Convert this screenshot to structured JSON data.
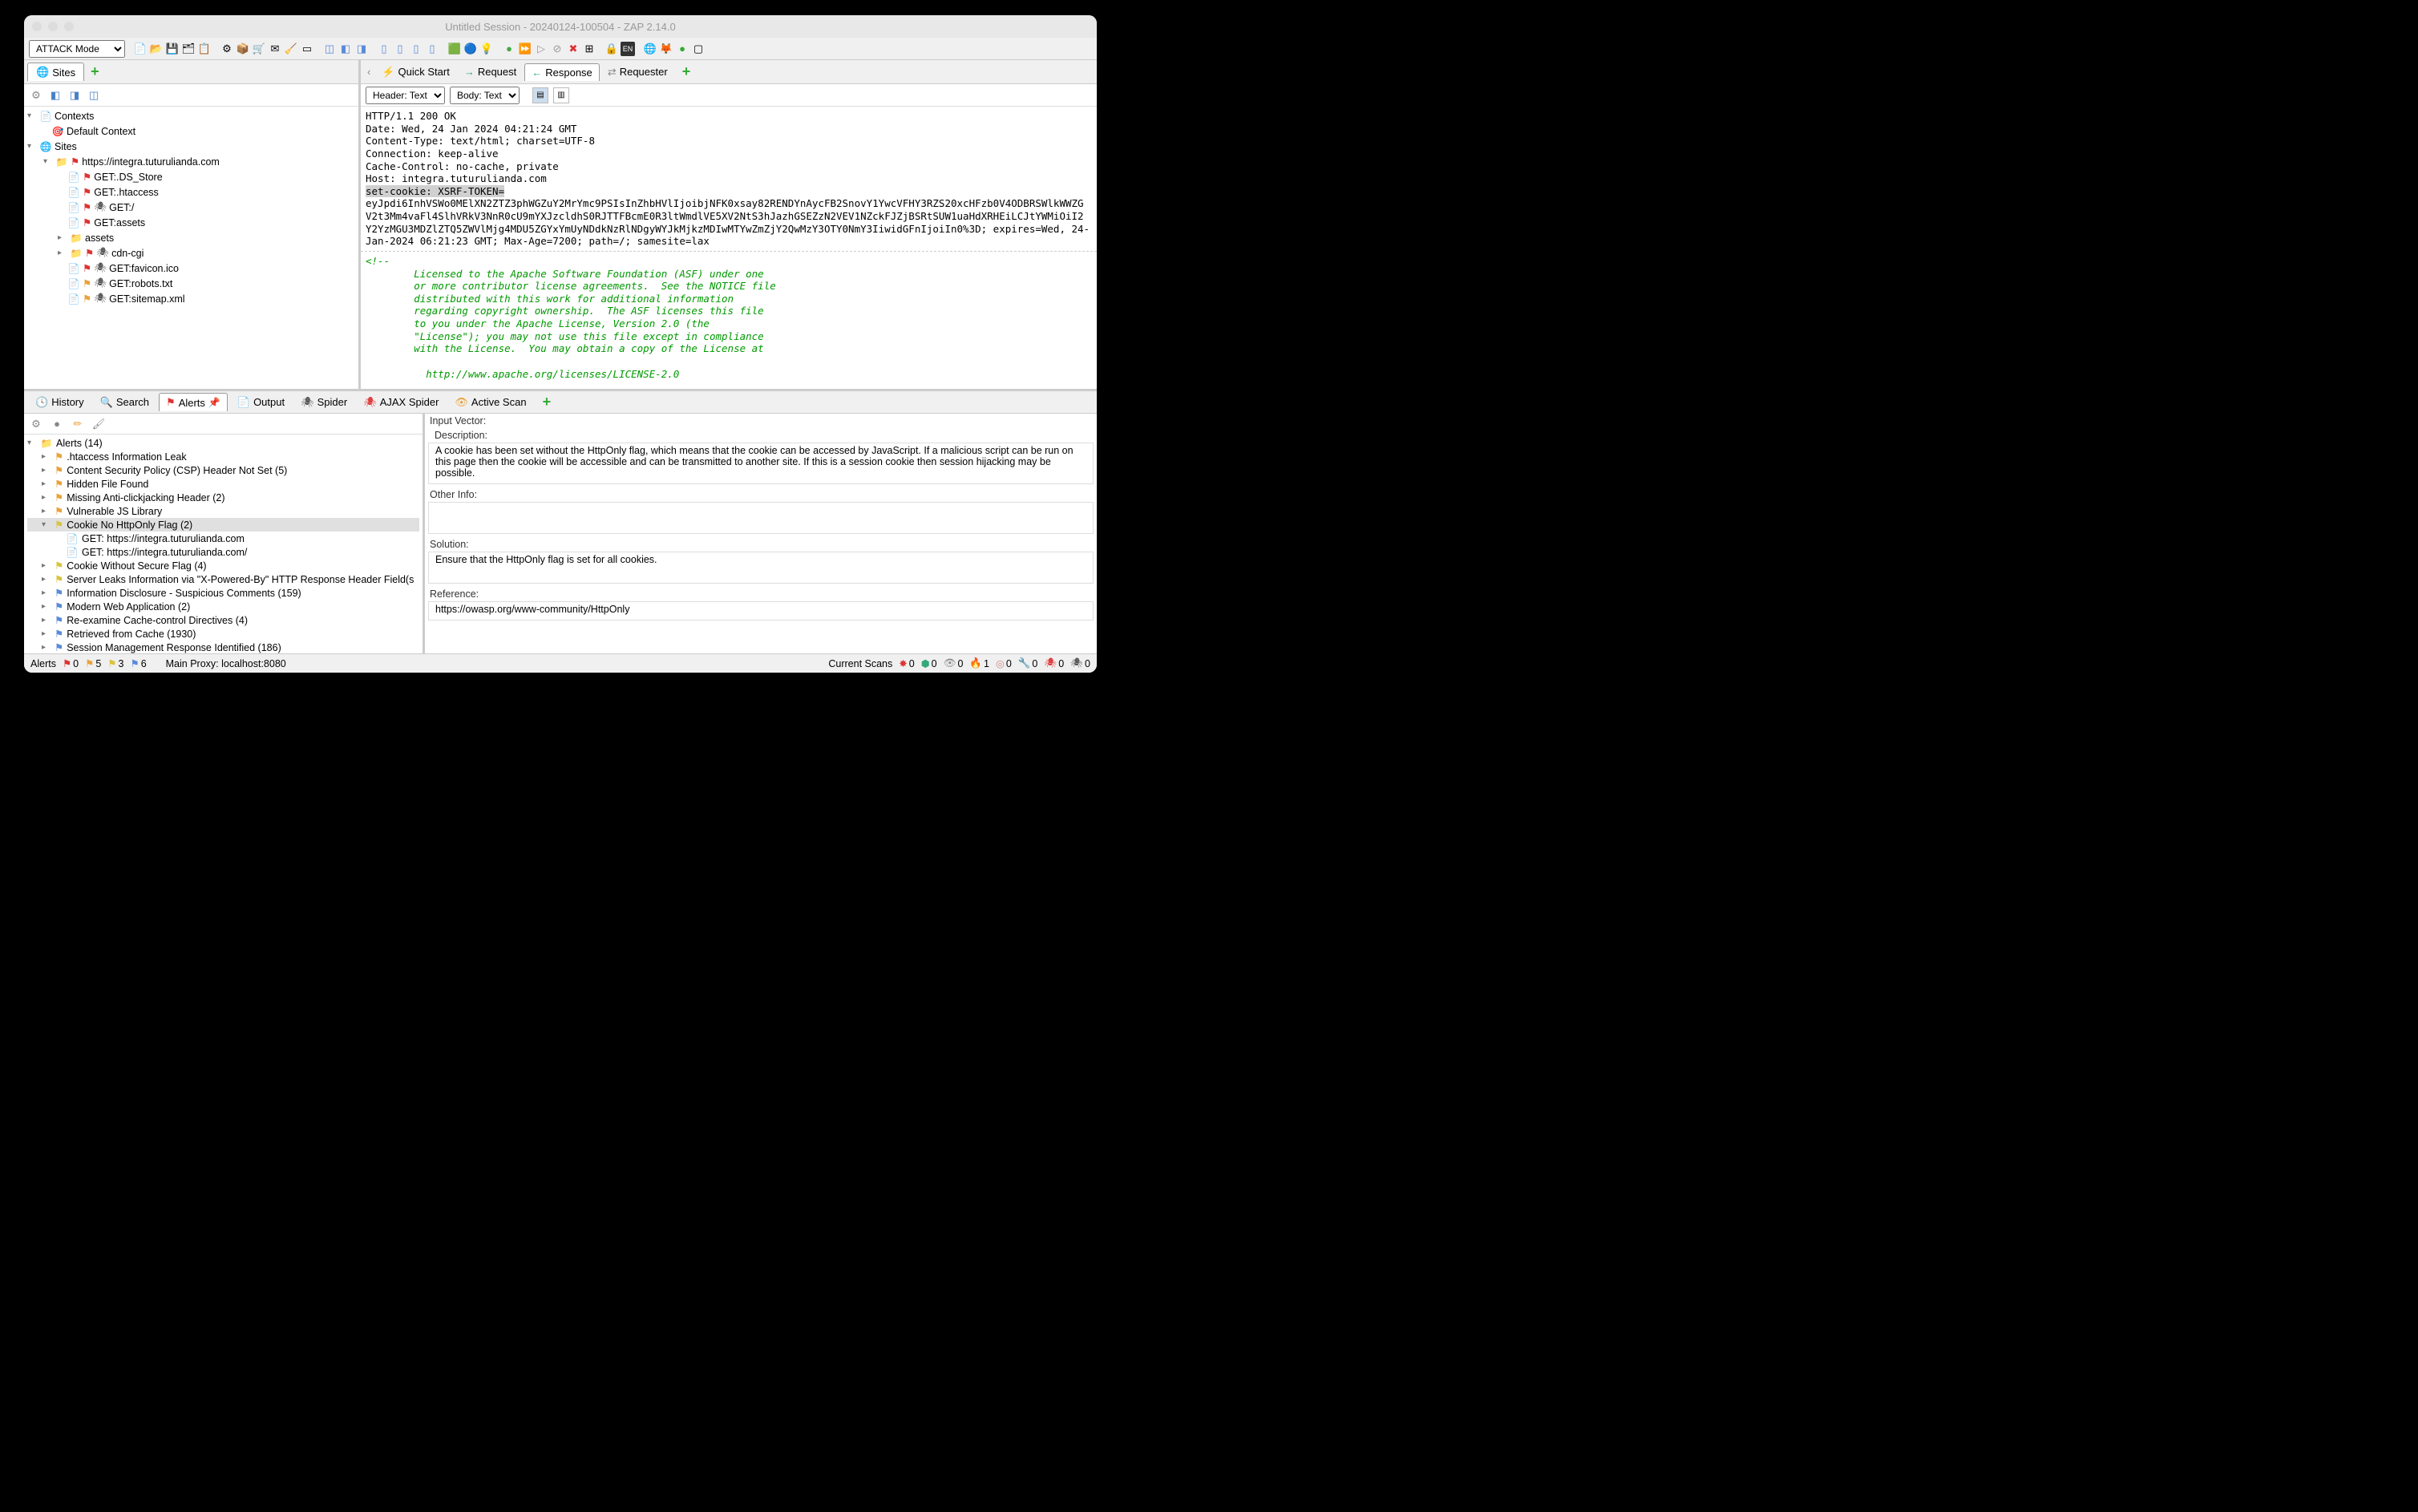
{
  "window": {
    "title": "Untitled Session - 20240124-100504 - ZAP 2.14.0"
  },
  "mode": {
    "value": "ATTACK Mode"
  },
  "sites_tab": {
    "label": "Sites"
  },
  "tree": {
    "contexts": "Contexts",
    "default_context": "Default Context",
    "sites": "Sites",
    "site_host": "https://integra.tuturulianda.com",
    "items": [
      {
        "label": "GET:.DS_Store",
        "flag": "red"
      },
      {
        "label": "GET:.htaccess",
        "flag": "red"
      },
      {
        "label": "GET:/",
        "flag": "red",
        "spider": true
      },
      {
        "label": "GET:assets",
        "flag": "red"
      },
      {
        "label": "assets",
        "folder": true
      },
      {
        "label": "cdn-cgi",
        "folder": true,
        "flag": "red",
        "spider": true
      },
      {
        "label": "GET:favicon.ico",
        "flag": "red",
        "spider": true
      },
      {
        "label": "GET:robots.txt",
        "flag": "orange",
        "spider": true
      },
      {
        "label": "GET:sitemap.xml",
        "flag": "orange",
        "spider": true
      }
    ]
  },
  "right_tabs": {
    "quick_start": "Quick Start",
    "request": "Request",
    "response": "Response",
    "requester": "Requester"
  },
  "header_sel": "Header: Text",
  "body_sel": "Body: Text",
  "http_header": {
    "lines_pre": "HTTP/1.1 200 OK\nDate: Wed, 24 Jan 2024 04:21:24 GMT\nContent-Type: text/html; charset=UTF-8\nConnection: keep-alive\nCache-Control: no-cache, private\nHost: integra.tuturulianda.com\n",
    "hl": "set-cookie: XSRF-TOKEN=",
    "line_rest": "\neyJpdi6InhVSWo0MElXN2ZTZ3phWGZuY2MrYmc9PSIsInZhbHVlIjoibjNFK0xsay82RENDYnAycFB2SnovY1YwcVFHY3RZS20xcHFzb0V4ODBRSWlkWWZG\nV2t3Mm4vaFl4SlhVRkV3NnR0cU9mYXJzcldhS0RJTTFBcmE0R3ltWmdlVE5XV2NtS3hJazhGSEZzN2VEV1NZckFJZjBSRtSUW1uaHdXRHEiLCJtYWMiOiI2\nY2YzMGU3MDZlZTQ5ZWVlMjg4MDU5ZGYxYmUyNDdkNzRlNDgyWYJkMjkzMDIwMTYwZmZjY2QwMzY3OTY0NmY3IiwidGFnIjoiIn0%3D; expires=Wed, 24-\nJan-2024 06:21:23 GMT; Max-Age=7200; path=/; samesite=lax"
  },
  "http_body": "<!--\n        Licensed to the Apache Software Foundation (ASF) under one\n        or more contributor license agreements.  See the NOTICE file\n        distributed with this work for additional information\n        regarding copyright ownership.  The ASF licenses this file\n        to you under the Apache License, Version 2.0 (the\n        \"License\"); you may not use this file except in compliance\n        with the License.  You may obtain a copy of the License at\n\n          http://www.apache.org/licenses/LICENSE-2.0",
  "bottom_tabs": {
    "history": "History",
    "search": "Search",
    "alerts": "Alerts",
    "output": "Output",
    "spider": "Spider",
    "ajax_spider": "AJAX Spider",
    "active_scan": "Active Scan"
  },
  "alerts_root": "Alerts (14)",
  "alerts": [
    {
      "label": ".htaccess Information Leak",
      "flag": "orange"
    },
    {
      "label": "Content Security Policy (CSP) Header Not Set (5)",
      "flag": "orange"
    },
    {
      "label": "Hidden File Found",
      "flag": "orange"
    },
    {
      "label": "Missing Anti-clickjacking Header (2)",
      "flag": "orange"
    },
    {
      "label": "Vulnerable JS Library",
      "flag": "orange"
    },
    {
      "label": "Cookie No HttpOnly Flag (2)",
      "flag": "yellow",
      "selected": true,
      "expanded": true,
      "children": [
        "GET: https://integra.tuturulianda.com",
        "GET: https://integra.tuturulianda.com/"
      ]
    },
    {
      "label": "Cookie Without Secure Flag (4)",
      "flag": "yellow"
    },
    {
      "label": "Server Leaks Information via \"X-Powered-By\" HTTP Response Header Field(s",
      "flag": "yellow"
    },
    {
      "label": "Information Disclosure - Suspicious Comments (159)",
      "flag": "blue"
    },
    {
      "label": "Modern Web Application (2)",
      "flag": "blue"
    },
    {
      "label": "Re-examine Cache-control Directives (4)",
      "flag": "blue"
    },
    {
      "label": "Retrieved from Cache (1930)",
      "flag": "blue"
    },
    {
      "label": "Session Management Response Identified (186)",
      "flag": "blue"
    }
  ],
  "detail": {
    "input_vector_label": "Input Vector:",
    "description_label": "Description:",
    "description": "A cookie has been set without the HttpOnly flag, which means that the cookie can be accessed by JavaScript. If a malicious script can be run on this page then the cookie will be accessible and can be transmitted to another site. If this is a session cookie then session hijacking may be possible.",
    "other_info_label": "Other Info:",
    "solution_label": "Solution:",
    "solution": "Ensure that the HttpOnly flag is set for all cookies.",
    "reference_label": "Reference:",
    "reference": "https://owasp.org/www-community/HttpOnly"
  },
  "statusbar": {
    "alerts_label": "Alerts",
    "c0": "0",
    "c1": "5",
    "c2": "3",
    "c3": "6",
    "proxy": "Main Proxy: localhost:8080",
    "scans_label": "Current Scans",
    "sc": [
      "0",
      "0",
      "0",
      "1",
      "0",
      "0",
      "0",
      "0"
    ]
  }
}
